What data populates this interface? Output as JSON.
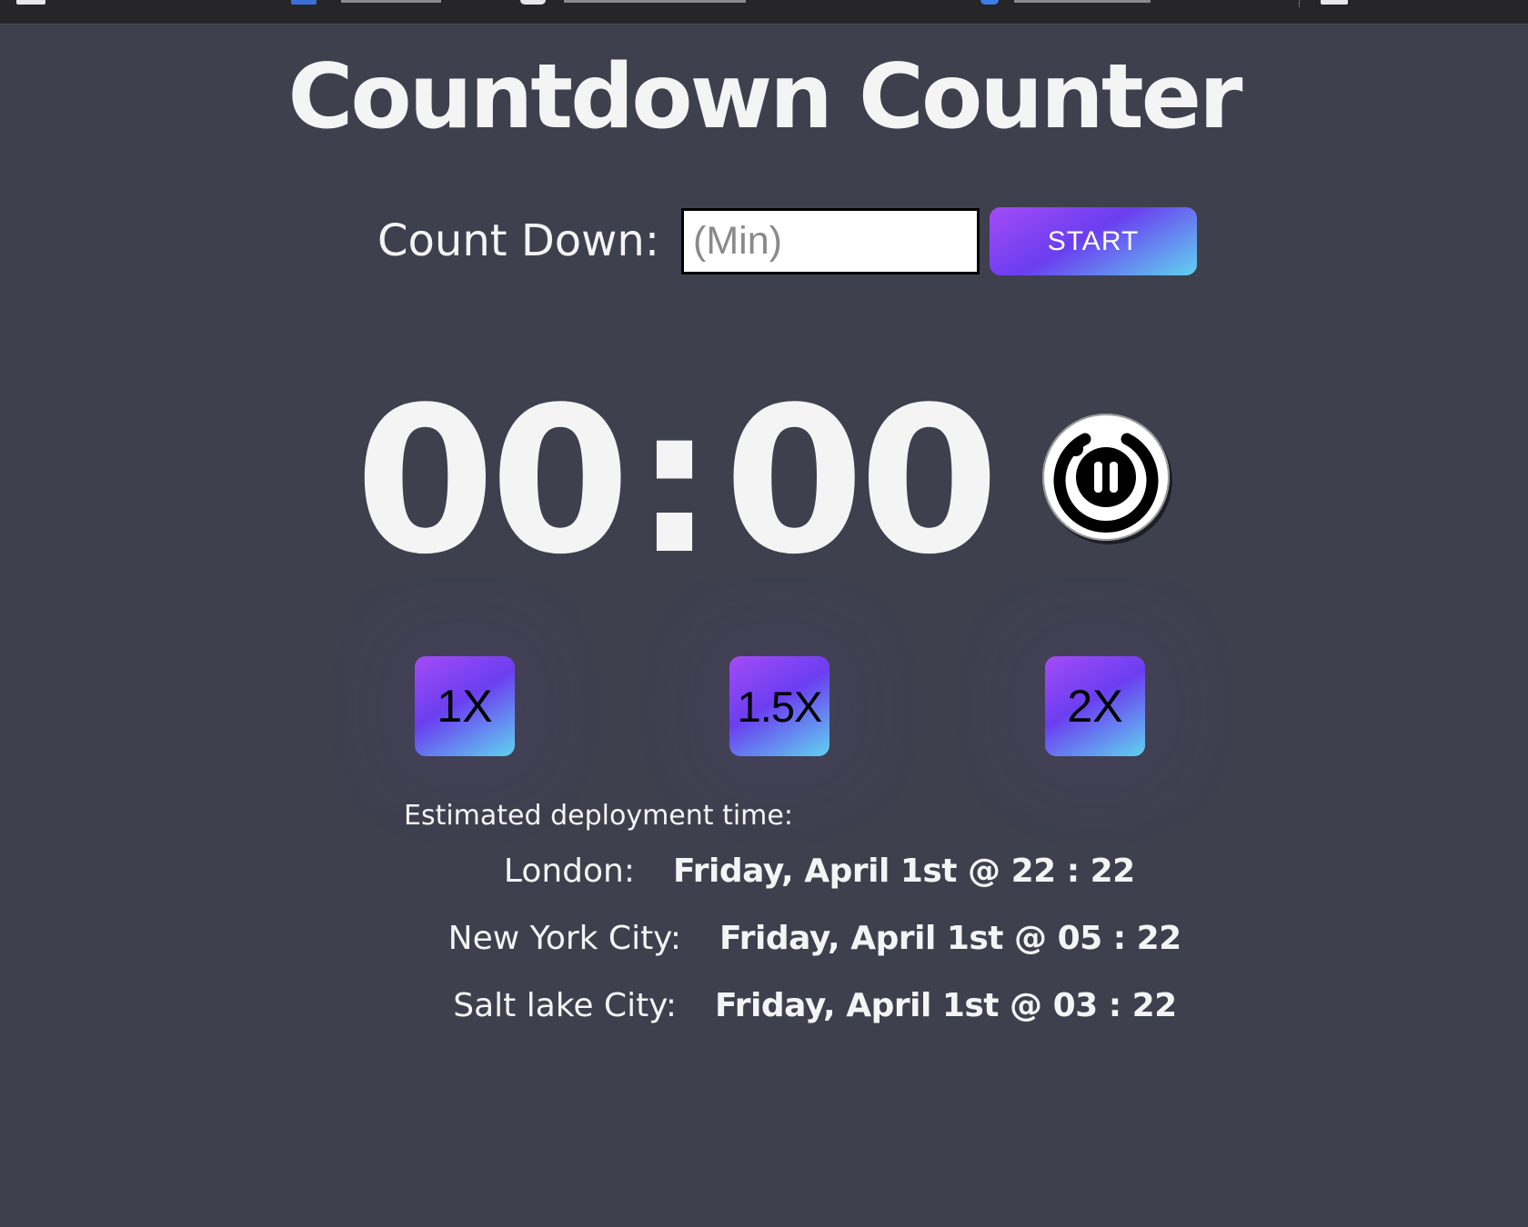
{
  "app": {
    "title": "Countdown Counter"
  },
  "countdown": {
    "label": "Count Down:",
    "input_value": "",
    "input_placeholder": "(Min)",
    "start_label": "START"
  },
  "timer": {
    "minutes": "00",
    "separator": ":",
    "seconds": "00"
  },
  "speeds": [
    {
      "label": "1X"
    },
    {
      "label": "1.5X"
    },
    {
      "label": "2X"
    }
  ],
  "deployment": {
    "label": "Estimated deployment time:",
    "cities": [
      {
        "name": "London:",
        "time": "Friday, April 1st @ 22 : 22"
      },
      {
        "name": "New York City:",
        "time": "Friday, April 1st @ 05 : 22"
      },
      {
        "name": "Salt lake City:",
        "time": "Friday, April 1st @ 03 : 22"
      }
    ]
  },
  "icons": {
    "pause": "pause-icon"
  },
  "colors": {
    "background": "#3f404e",
    "text": "#f4f4f4",
    "gradient_start": "#a44cf6",
    "gradient_mid": "#6b3ef0",
    "gradient_end": "#5fd3ef"
  }
}
